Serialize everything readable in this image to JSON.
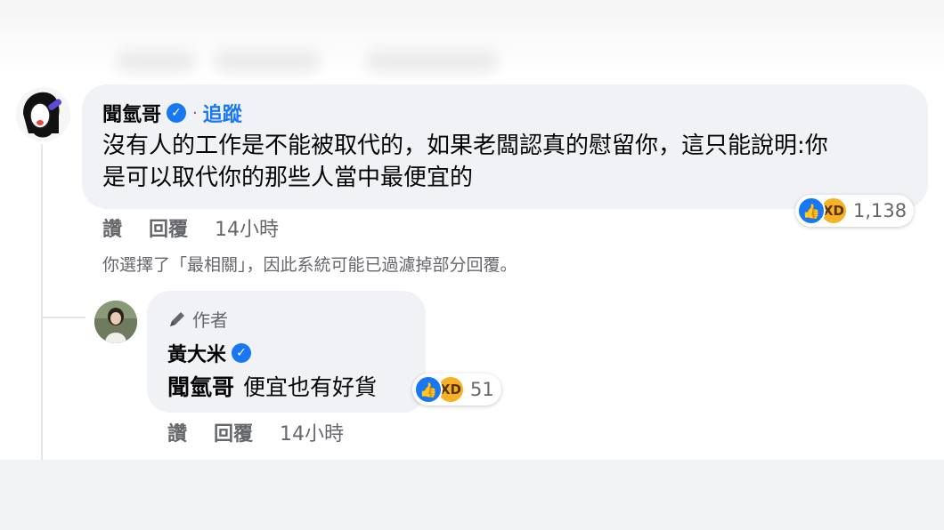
{
  "comment": {
    "author": "聞氫哥",
    "follow_label": "追蹤",
    "separator": "·",
    "text_line1": "沒有人的工作是不能被取代的，如果老闆認真的慰留你，這只能說明:你",
    "text_line2": "是可以取代你的那些人當中最便宜的",
    "reaction_count": "1,138",
    "like_label": "讚",
    "reply_label": "回覆",
    "time": "14小時"
  },
  "filter_note": "你選擇了「最相關」，因此系統可能已過濾掉部分回覆。",
  "reply": {
    "author_badge": "作者",
    "author": "黃大米",
    "mention": "聞氫哥",
    "text": "便宜也有好貨",
    "reaction_count": "51",
    "like_label": "讚",
    "reply_label": "回覆",
    "time": "14小時"
  },
  "icons": {
    "verified": "verified-badge-icon",
    "like": "like-reaction-icon",
    "haha": "haha-reaction-icon",
    "author": "pen-icon"
  },
  "colors": {
    "accent": "#1877f2",
    "bubble": "#f0f2f5",
    "muted_text": "#65676b"
  }
}
